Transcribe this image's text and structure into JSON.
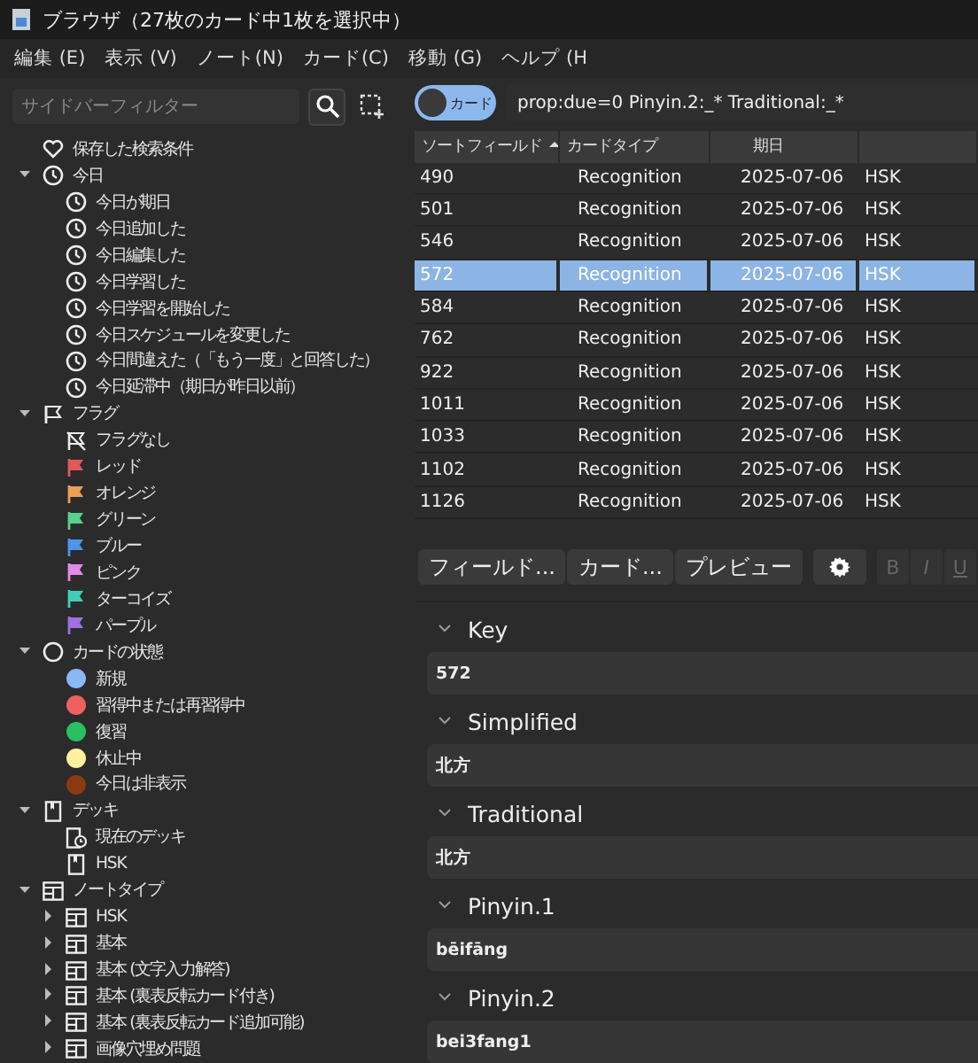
{
  "window": {
    "title": "ブラウザ（27枚のカード中1枚を選択中）"
  },
  "menu": [
    "編集 (E)",
    "表示 (V)",
    "ノート(N)",
    "カード(C)",
    "移動 (G)",
    "ヘルプ (H"
  ],
  "sidebar": {
    "filter": {
      "placeholder": "サイドバーフィルター"
    },
    "items": [
      {
        "label": "保存した検索条件",
        "kind": "heart"
      },
      {
        "label": "今日",
        "kind": "clock",
        "expanded": true,
        "children": [
          {
            "label": "今日が期日",
            "kind": "clock"
          },
          {
            "label": "今日追加した",
            "kind": "clock"
          },
          {
            "label": "今日編集した",
            "kind": "clock"
          },
          {
            "label": "今日学習した",
            "kind": "clock"
          },
          {
            "label": "今日学習を開始した",
            "kind": "clock"
          },
          {
            "label": "今日スケジュールを変更した",
            "kind": "clock"
          },
          {
            "label": "今日間違えた（「もう一度」と回答した）",
            "kind": "clock"
          },
          {
            "label": "今日延滞中（期日が昨日以前）",
            "kind": "clock"
          }
        ]
      },
      {
        "label": "フラグ",
        "kind": "flag",
        "expanded": true,
        "children": [
          {
            "label": "フラグなし",
            "kind": "flag-off"
          },
          {
            "label": "レッド",
            "kind": "flag",
            "color": "#e05a5a"
          },
          {
            "label": "オレンジ",
            "kind": "flag",
            "color": "#eba055"
          },
          {
            "label": "グリーン",
            "kind": "flag",
            "color": "#5ad08a"
          },
          {
            "label": "ブルー",
            "kind": "flag",
            "color": "#4e94e8"
          },
          {
            "label": "ピンク",
            "kind": "flag",
            "color": "#e28ae8"
          },
          {
            "label": "ターコイズ",
            "kind": "flag",
            "color": "#3fcfb8"
          },
          {
            "label": "パープル",
            "kind": "flag",
            "color": "#a070e0"
          }
        ]
      },
      {
        "label": "カードの状態",
        "kind": "circle",
        "expanded": true,
        "children": [
          {
            "label": "新規",
            "kind": "dot",
            "color": "#8ab8f5"
          },
          {
            "label": "習得中または再習得中",
            "kind": "dot",
            "color": "#f06060"
          },
          {
            "label": "復習",
            "kind": "dot",
            "color": "#28c060"
          },
          {
            "label": "休止中",
            "kind": "dot",
            "color": "#fff0a0"
          },
          {
            "label": "今日は非表示",
            "kind": "dot",
            "color": "#8a3a10"
          }
        ]
      },
      {
        "label": "デッキ",
        "kind": "deck",
        "expanded": true,
        "children": [
          {
            "label": "現在のデッキ",
            "kind": "current-deck"
          },
          {
            "label": "HSK",
            "kind": "deck"
          }
        ]
      },
      {
        "label": "ノートタイプ",
        "kind": "notetype",
        "expanded": true,
        "children": [
          {
            "label": "HSK",
            "kind": "notetype",
            "expanded": false
          },
          {
            "label": "基本",
            "kind": "notetype",
            "expanded": false
          },
          {
            "label": "基本 (文字入力解答)",
            "kind": "notetype",
            "expanded": false
          },
          {
            "label": "基本 (裏表反転カード付き)",
            "kind": "notetype",
            "expanded": false
          },
          {
            "label": "基本 (裏表反転カード追加可能)",
            "kind": "notetype",
            "expanded": false
          },
          {
            "label": "画像穴埋め問題",
            "kind": "notetype",
            "expanded": false
          }
        ]
      }
    ]
  },
  "toggle": {
    "label": "カード"
  },
  "search": {
    "value": "prop:due=0 Pinyin.2:_* Traditional:_*"
  },
  "table": {
    "columns": [
      {
        "label": "ソートフィールド",
        "sorted": true
      },
      {
        "label": "カードタイプ",
        "sorted": false
      },
      {
        "label": "期日",
        "sorted": false
      }
    ],
    "rows": [
      {
        "cells": [
          "490",
          "Recognition",
          "2025-07-06",
          "HSK"
        ],
        "selected": false
      },
      {
        "cells": [
          "501",
          "Recognition",
          "2025-07-06",
          "HSK"
        ],
        "selected": false
      },
      {
        "cells": [
          "546",
          "Recognition",
          "2025-07-06",
          "HSK"
        ],
        "selected": false
      },
      {
        "cells": [
          "572",
          "Recognition",
          "2025-07-06",
          "HSK"
        ],
        "selected": true
      },
      {
        "cells": [
          "584",
          "Recognition",
          "2025-07-06",
          "HSK"
        ],
        "selected": false
      },
      {
        "cells": [
          "762",
          "Recognition",
          "2025-07-06",
          "HSK"
        ],
        "selected": false
      },
      {
        "cells": [
          "922",
          "Recognition",
          "2025-07-06",
          "HSK"
        ],
        "selected": false
      },
      {
        "cells": [
          "1011",
          "Recognition",
          "2025-07-06",
          "HSK"
        ],
        "selected": false
      },
      {
        "cells": [
          "1033",
          "Recognition",
          "2025-07-06",
          "HSK"
        ],
        "selected": false
      },
      {
        "cells": [
          "1102",
          "Recognition",
          "2025-07-06",
          "HSK"
        ],
        "selected": false
      },
      {
        "cells": [
          "1126",
          "Recognition",
          "2025-07-06",
          "HSK"
        ],
        "selected": false
      }
    ]
  },
  "editor": {
    "buttons": [
      "フィールド...",
      "カード...",
      "プレビュー"
    ],
    "format_buttons": [
      {
        "label": "B",
        "disabled": true
      },
      {
        "label": "I",
        "disabled": true
      },
      {
        "label": "U",
        "disabled": true
      }
    ],
    "fields": [
      {
        "name": "Key",
        "value": "572",
        "expanded": true
      },
      {
        "name": "Simplified",
        "value": "北方",
        "expanded": true
      },
      {
        "name": "Traditional",
        "value": "北方",
        "expanded": true
      },
      {
        "name": "Pinyin.1",
        "value": "bēifāng",
        "expanded": true
      },
      {
        "name": "Pinyin.2",
        "value": "bei3fang1",
        "expanded": true
      }
    ]
  }
}
